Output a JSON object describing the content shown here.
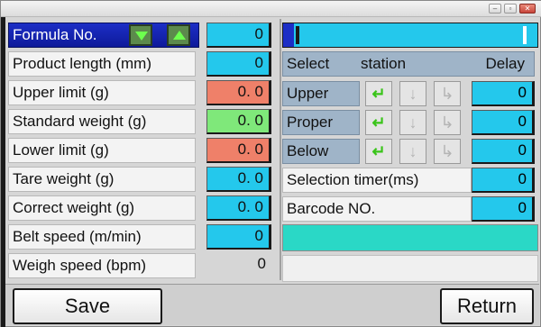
{
  "window": {
    "controls": [
      "minimize",
      "maximize",
      "close"
    ]
  },
  "formula": {
    "label": "Formula No.",
    "value": "0"
  },
  "params": [
    {
      "label": "Product length (mm)",
      "value": "0",
      "style": "cyan"
    },
    {
      "label": "Upper limit (g)",
      "value": "0. 0",
      "style": "salmon"
    },
    {
      "label": "Standard weight (g)",
      "value": "0. 0",
      "style": "green"
    },
    {
      "label": "Lower limit (g)",
      "value": "0. 0",
      "style": "salmon"
    },
    {
      "label": "Tare weight (g)",
      "value": "0. 0",
      "style": "cyan"
    },
    {
      "label": "Correct weight (g)",
      "value": "0. 0",
      "style": "cyan"
    },
    {
      "label": "Belt speed (m/min)",
      "value": "0",
      "style": "cyan"
    },
    {
      "label": "Weigh speed (bpm)",
      "value": "0",
      "style": "plain"
    }
  ],
  "selection": {
    "header": {
      "select": "Select",
      "station": "station",
      "delay": "Delay"
    },
    "stations": [
      {
        "label": "Upper",
        "delay": "0"
      },
      {
        "label": "Proper",
        "delay": "0"
      },
      {
        "label": "Below",
        "delay": "0"
      }
    ],
    "timer": {
      "label": "Selection timer(ms)",
      "value": "0"
    },
    "barcode": {
      "label": "Barcode NO.",
      "value": "0"
    }
  },
  "buttons": {
    "save": "Save",
    "return": "Return"
  },
  "colors": {
    "cyan": "#24c8ec",
    "salmon": "#ef8069",
    "green": "#7fe87a",
    "navy": "#1c2ec6",
    "teal": "#2ad8c6"
  },
  "icons": {
    "enter": "return-arrow-icon",
    "down": "down-arrow-icon",
    "turn": "turn-right-icon"
  }
}
